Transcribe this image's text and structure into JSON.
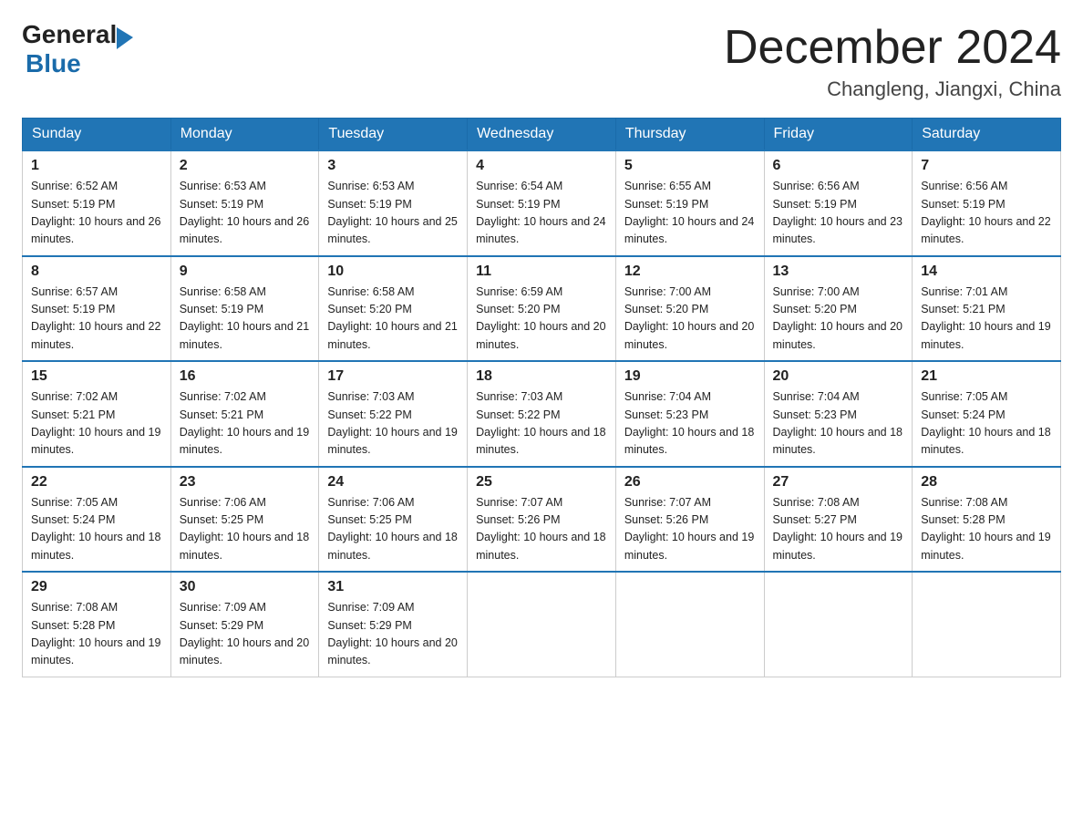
{
  "header": {
    "logo_general": "General",
    "logo_blue": "Blue",
    "month_title": "December 2024",
    "location": "Changleng, Jiangxi, China"
  },
  "weekdays": [
    "Sunday",
    "Monday",
    "Tuesday",
    "Wednesday",
    "Thursday",
    "Friday",
    "Saturday"
  ],
  "weeks": [
    [
      {
        "day": "1",
        "sunrise": "6:52 AM",
        "sunset": "5:19 PM",
        "daylight": "10 hours and 26 minutes."
      },
      {
        "day": "2",
        "sunrise": "6:53 AM",
        "sunset": "5:19 PM",
        "daylight": "10 hours and 26 minutes."
      },
      {
        "day": "3",
        "sunrise": "6:53 AM",
        "sunset": "5:19 PM",
        "daylight": "10 hours and 25 minutes."
      },
      {
        "day": "4",
        "sunrise": "6:54 AM",
        "sunset": "5:19 PM",
        "daylight": "10 hours and 24 minutes."
      },
      {
        "day": "5",
        "sunrise": "6:55 AM",
        "sunset": "5:19 PM",
        "daylight": "10 hours and 24 minutes."
      },
      {
        "day": "6",
        "sunrise": "6:56 AM",
        "sunset": "5:19 PM",
        "daylight": "10 hours and 23 minutes."
      },
      {
        "day": "7",
        "sunrise": "6:56 AM",
        "sunset": "5:19 PM",
        "daylight": "10 hours and 22 minutes."
      }
    ],
    [
      {
        "day": "8",
        "sunrise": "6:57 AM",
        "sunset": "5:19 PM",
        "daylight": "10 hours and 22 minutes."
      },
      {
        "day": "9",
        "sunrise": "6:58 AM",
        "sunset": "5:19 PM",
        "daylight": "10 hours and 21 minutes."
      },
      {
        "day": "10",
        "sunrise": "6:58 AM",
        "sunset": "5:20 PM",
        "daylight": "10 hours and 21 minutes."
      },
      {
        "day": "11",
        "sunrise": "6:59 AM",
        "sunset": "5:20 PM",
        "daylight": "10 hours and 20 minutes."
      },
      {
        "day": "12",
        "sunrise": "7:00 AM",
        "sunset": "5:20 PM",
        "daylight": "10 hours and 20 minutes."
      },
      {
        "day": "13",
        "sunrise": "7:00 AM",
        "sunset": "5:20 PM",
        "daylight": "10 hours and 20 minutes."
      },
      {
        "day": "14",
        "sunrise": "7:01 AM",
        "sunset": "5:21 PM",
        "daylight": "10 hours and 19 minutes."
      }
    ],
    [
      {
        "day": "15",
        "sunrise": "7:02 AM",
        "sunset": "5:21 PM",
        "daylight": "10 hours and 19 minutes."
      },
      {
        "day": "16",
        "sunrise": "7:02 AM",
        "sunset": "5:21 PM",
        "daylight": "10 hours and 19 minutes."
      },
      {
        "day": "17",
        "sunrise": "7:03 AM",
        "sunset": "5:22 PM",
        "daylight": "10 hours and 19 minutes."
      },
      {
        "day": "18",
        "sunrise": "7:03 AM",
        "sunset": "5:22 PM",
        "daylight": "10 hours and 18 minutes."
      },
      {
        "day": "19",
        "sunrise": "7:04 AM",
        "sunset": "5:23 PM",
        "daylight": "10 hours and 18 minutes."
      },
      {
        "day": "20",
        "sunrise": "7:04 AM",
        "sunset": "5:23 PM",
        "daylight": "10 hours and 18 minutes."
      },
      {
        "day": "21",
        "sunrise": "7:05 AM",
        "sunset": "5:24 PM",
        "daylight": "10 hours and 18 minutes."
      }
    ],
    [
      {
        "day": "22",
        "sunrise": "7:05 AM",
        "sunset": "5:24 PM",
        "daylight": "10 hours and 18 minutes."
      },
      {
        "day": "23",
        "sunrise": "7:06 AM",
        "sunset": "5:25 PM",
        "daylight": "10 hours and 18 minutes."
      },
      {
        "day": "24",
        "sunrise": "7:06 AM",
        "sunset": "5:25 PM",
        "daylight": "10 hours and 18 minutes."
      },
      {
        "day": "25",
        "sunrise": "7:07 AM",
        "sunset": "5:26 PM",
        "daylight": "10 hours and 18 minutes."
      },
      {
        "day": "26",
        "sunrise": "7:07 AM",
        "sunset": "5:26 PM",
        "daylight": "10 hours and 19 minutes."
      },
      {
        "day": "27",
        "sunrise": "7:08 AM",
        "sunset": "5:27 PM",
        "daylight": "10 hours and 19 minutes."
      },
      {
        "day": "28",
        "sunrise": "7:08 AM",
        "sunset": "5:28 PM",
        "daylight": "10 hours and 19 minutes."
      }
    ],
    [
      {
        "day": "29",
        "sunrise": "7:08 AM",
        "sunset": "5:28 PM",
        "daylight": "10 hours and 19 minutes."
      },
      {
        "day": "30",
        "sunrise": "7:09 AM",
        "sunset": "5:29 PM",
        "daylight": "10 hours and 20 minutes."
      },
      {
        "day": "31",
        "sunrise": "7:09 AM",
        "sunset": "5:29 PM",
        "daylight": "10 hours and 20 minutes."
      },
      null,
      null,
      null,
      null
    ]
  ]
}
